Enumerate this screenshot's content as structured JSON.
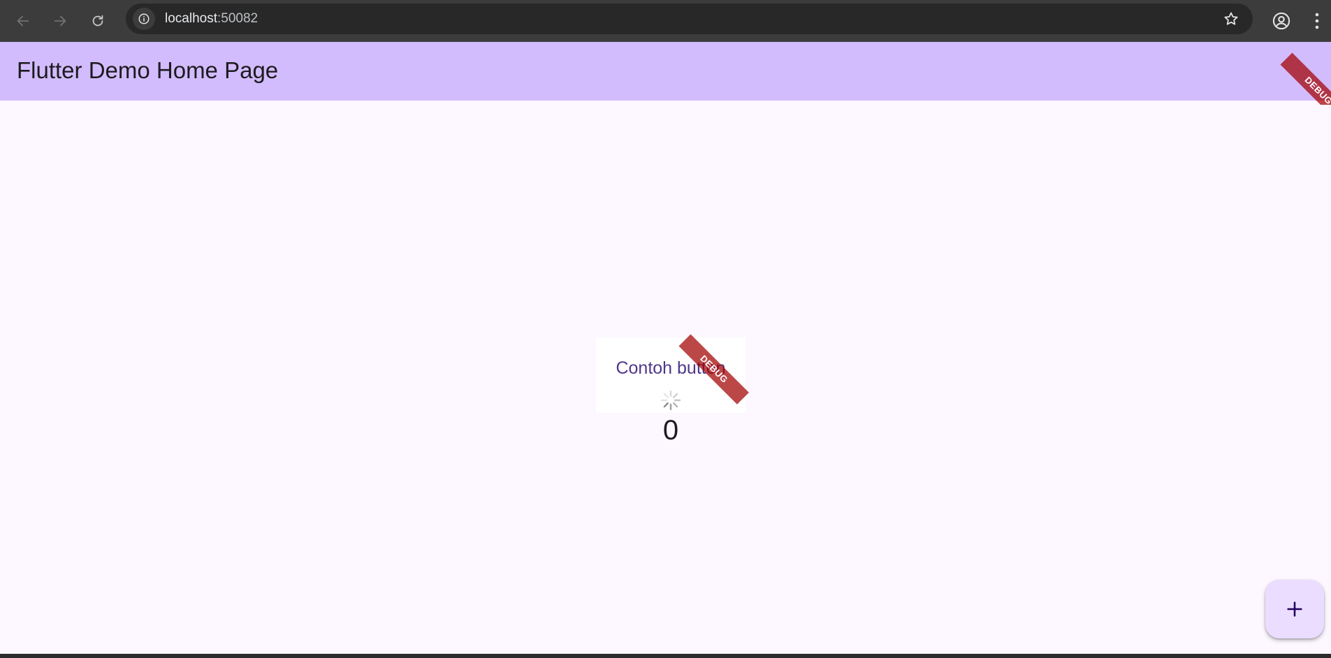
{
  "browser": {
    "url_host": "localhost",
    "url_port": ":50082",
    "icons": {
      "back": "arrow-left-icon",
      "forward": "arrow-right-icon",
      "reload": "reload-icon",
      "site_info": "info-icon",
      "bookmark": "star-icon",
      "profile": "account-circle-icon",
      "menu": "kebab-menu-icon"
    }
  },
  "app": {
    "title": "Flutter Demo Home Page",
    "debug_banner": "DEBUG",
    "button_label": "Contoh button",
    "counter": "0",
    "fab_icon": "plus-icon"
  },
  "colors": {
    "app_bar": "#d3bcfd",
    "background": "#fdf7ff",
    "fab": "#eaddff",
    "button_text": "#4f378a",
    "debug_ribbon": "#a20000"
  }
}
